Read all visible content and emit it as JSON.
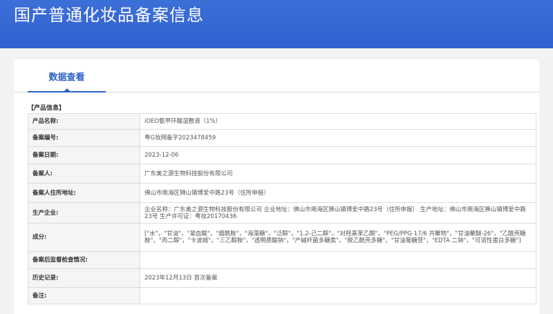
{
  "header": {
    "title": "国产普通化妆品备案信息"
  },
  "tabs": [
    {
      "label": "数据查看"
    }
  ],
  "section": {
    "title": "【产品信息】"
  },
  "rows": [
    {
      "label": "产品名称:",
      "value": "iOEO氨甲环酸湿敷液（1%）"
    },
    {
      "label": "备案编号:",
      "value": "粤G妆网备字2023478459"
    },
    {
      "label": "备案日期:",
      "value": "2023-12-06"
    },
    {
      "label": "备案人:",
      "value": "广东美之源生物科技股份有限公司"
    },
    {
      "label": "备案人住所地址:",
      "value": "佛山市南海区狮山镇博爱中路23号（住所申报）"
    },
    {
      "label": "生产企业:",
      "value": "企业名称：广东美之源生物科技股份有限公司 企业地址：佛山市南海区狮山镇博爱中路23号（住所申报） 生产地址：佛山市南海区狮山镇博爱中路23号 生产许可证：粤妆20170436"
    },
    {
      "label": "成分:",
      "value": "[\"水\"，\"甘油\"，\"凝血酸\"，\"烟酰胺\"，\"海藻糖\"，\"泛醇\"，\"1,2-己二醇\"，\"对羟基苯乙酮\"，\"PEG/PPG-17/6 共聚物\"，\"甘油聚醚-26\"，\"乙酰壳糖胺\"，\"丙二醇\"，\"卡波姆\"，\"三乙醇胺\"，\"透明质酸钠\"，\"产碱杆菌多糖类\"，\"脱乙酰壳多糖\"，\"甘油葡糖苷\"，\"EDTA 二钠\"，\"可溶性蛋白多糖\"]"
    },
    {
      "label": "备案后监督检查情况:",
      "value": ""
    },
    {
      "label": "历史记录:",
      "value": "2023年12月13日 首次备案"
    },
    {
      "label": "备注:",
      "value": ""
    }
  ]
}
